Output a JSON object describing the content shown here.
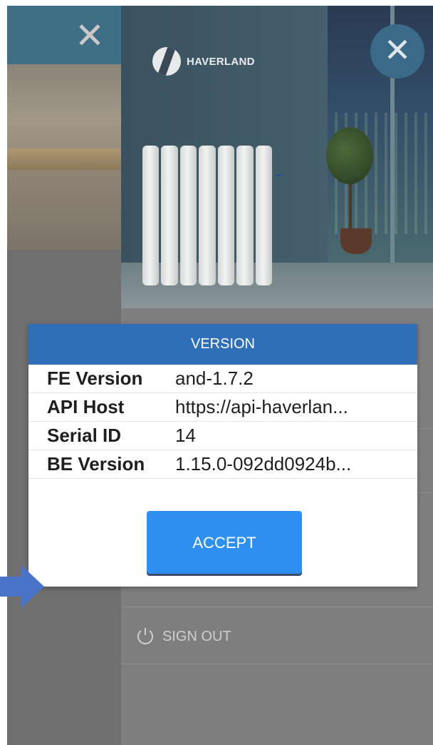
{
  "background": {
    "brand": "HAVERLAND",
    "menu": {
      "signout_label": "SIGN OUT"
    }
  },
  "dialog": {
    "title": "VERSION",
    "rows": [
      {
        "label": "FE Version",
        "value": "and-1.7.2"
      },
      {
        "label": "API Host",
        "value": "https://api-haverlan..."
      },
      {
        "label": "Serial ID",
        "value": "14"
      },
      {
        "label": "BE Version",
        "value": "1.15.0-092dd0924b..."
      }
    ],
    "accept_label": "ACCEPT"
  },
  "colors": {
    "dialog_header": "#2f6fb7",
    "accept_button": "#2e8ff0",
    "arrow": "#4a74c7"
  },
  "icons": [
    "close-icon",
    "power-icon",
    "haverland-logo",
    "arrow-right-icon"
  ]
}
